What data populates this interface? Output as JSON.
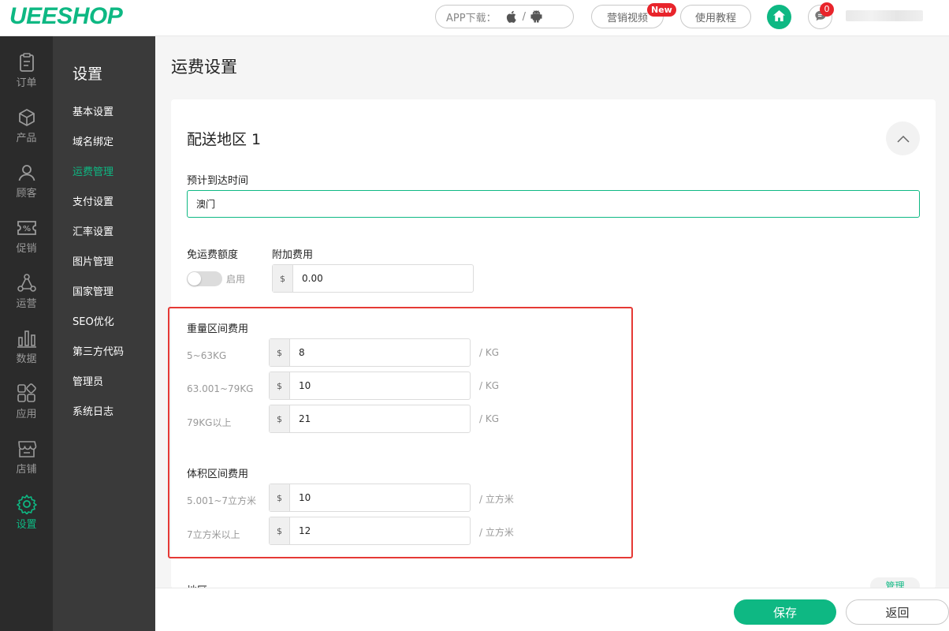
{
  "header": {
    "logo": "UEESHOP",
    "app_download_label": "APP下载：",
    "os_separator": "/",
    "marketing_video": "营销视频",
    "new_badge": "New",
    "tutorial": "使用教程",
    "message_count": "0"
  },
  "rail": {
    "items": [
      {
        "label": "订单",
        "icon": "clipboard-icon"
      },
      {
        "label": "产品",
        "icon": "box-icon"
      },
      {
        "label": "顾客",
        "icon": "user-icon"
      },
      {
        "label": "促销",
        "icon": "percent-ticket-icon"
      },
      {
        "label": "运营",
        "icon": "share-nodes-icon"
      },
      {
        "label": "数据",
        "icon": "bar-chart-icon"
      },
      {
        "label": "应用",
        "icon": "apps-icon"
      },
      {
        "label": "店铺",
        "icon": "store-icon"
      },
      {
        "label": "设置",
        "icon": "gear-icon"
      }
    ],
    "active": "设置"
  },
  "submenu": {
    "title": "设置",
    "items": [
      "基本设置",
      "域名绑定",
      "运费管理",
      "支付设置",
      "汇率设置",
      "图片管理",
      "国家管理",
      "SEO优化",
      "第三方代码",
      "管理员",
      "系统日志"
    ],
    "active": "运费管理"
  },
  "main": {
    "page_title": "运费设置",
    "zone": {
      "title": "配送地区 1",
      "arrival_label": "预计到达时间",
      "arrival_value": "澳门",
      "free_shipping_label": "免运费额度",
      "toggle_text": "启用",
      "extra_fee_label": "附加费用",
      "currency_symbol": "$",
      "extra_fee_value": "0.00",
      "weight_section_title": "重量区间费用",
      "weight_ranges": [
        {
          "range": "5~63KG",
          "value": "8",
          "unit": "/ KG"
        },
        {
          "range": "63.001~79KG",
          "value": "10",
          "unit": "/ KG"
        },
        {
          "range": "79KG以上",
          "value": "21",
          "unit": "/ KG"
        }
      ],
      "volume_section_title": "体积区间费用",
      "volume_ranges": [
        {
          "range": "5.001~7立方米",
          "value": "10",
          "unit": "/ 立方米"
        },
        {
          "range": "7立方米以上",
          "value": "12",
          "unit": "/ 立方米"
        }
      ],
      "region_label": "地区",
      "manage_link": "管理"
    }
  },
  "footer": {
    "save": "保存",
    "back": "返回"
  },
  "colors": {
    "accent": "#0eb883",
    "alert": "#e8242b",
    "highlight_border": "#e53935",
    "rail_bg": "#2b2b2b",
    "submenu_bg": "#3a3a3a"
  }
}
